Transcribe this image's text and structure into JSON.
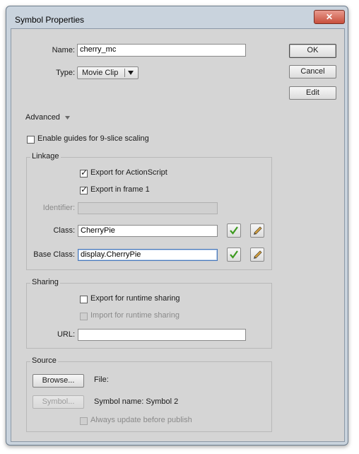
{
  "window": {
    "title": "Symbol Properties",
    "close_glyph": "✕"
  },
  "name": {
    "label": "Name:",
    "value": "cherry_mc"
  },
  "type": {
    "label": "Type:",
    "value": "Movie Clip"
  },
  "buttons": {
    "ok": "OK",
    "cancel": "Cancel",
    "edit": "Edit"
  },
  "advanced": {
    "label": "Advanced"
  },
  "nine_slice": {
    "label": "Enable guides for 9-slice scaling",
    "checked": false
  },
  "linkage": {
    "title": "Linkage",
    "export_actionscript": {
      "label": "Export for ActionScript",
      "checked": true
    },
    "export_frame1": {
      "label": "Export in frame 1",
      "checked": true
    },
    "identifier": {
      "label": "Identifier:",
      "value": ""
    },
    "class": {
      "label": "Class:",
      "value": "CherryPie"
    },
    "base_class": {
      "label": "Base Class:",
      "value": "display.CherryPie"
    }
  },
  "sharing": {
    "title": "Sharing",
    "export_runtime": {
      "label": "Export for runtime sharing",
      "checked": false
    },
    "import_runtime": {
      "label": "Import for runtime sharing",
      "checked": false
    },
    "url": {
      "label": "URL:",
      "value": ""
    }
  },
  "source": {
    "title": "Source",
    "browse_button": "Browse...",
    "file_label": "File:",
    "symbol_button": "Symbol...",
    "symbol_name": "Symbol name: Symbol 2",
    "always_update": {
      "label": "Always update before publish",
      "checked": false
    }
  },
  "icons": {
    "validate": "checkmark-icon",
    "edit_class": "pencil-icon",
    "dropdown": "chevron-down-icon",
    "advanced_toggle": "triangle-down-icon"
  },
  "colors": {
    "checkmark": "#3c9a1e",
    "client_bg": "#d5d5d5",
    "frame": "#c9d3dd"
  }
}
